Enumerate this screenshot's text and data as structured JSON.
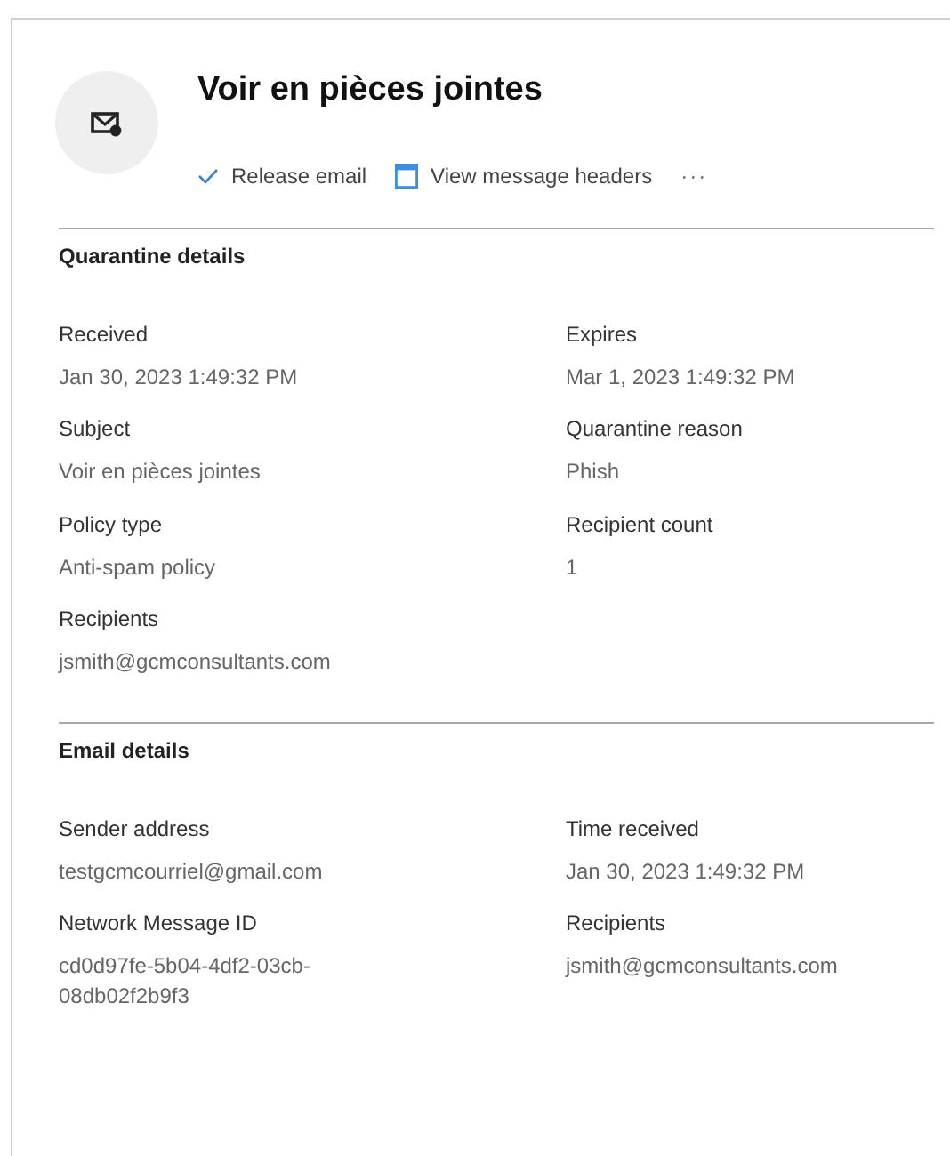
{
  "header": {
    "title": "Voir en pièces jointes",
    "actions": [
      {
        "kind": "check",
        "label": "Release email"
      },
      {
        "kind": "headers",
        "label": "View message headers"
      },
      {
        "kind": "more",
        "label": "···"
      }
    ]
  },
  "sections": [
    {
      "title": "Quarantine details",
      "fields": [
        {
          "label": "Received",
          "value": "Jan 30, 2023 1:49:32 PM"
        },
        {
          "label": "Expires",
          "value": "Mar 1, 2023 1:49:32 PM"
        },
        {
          "label": "Subject",
          "value": "Voir en pièces jointes"
        },
        {
          "label": "Quarantine reason",
          "value": "Phish"
        },
        {
          "label": "Policy type",
          "value": "Anti-spam policy"
        },
        {
          "label": "Recipient count",
          "value": "1"
        },
        {
          "label": "Recipients",
          "value": "jsmith@gcmconsultants.com"
        }
      ]
    },
    {
      "title": "Email details",
      "fields": [
        {
          "label": "Sender address",
          "value": "testgcmcourriel@gmail.com"
        },
        {
          "label": "Time received",
          "value": "Jan 30, 2023 1:49:32 PM"
        },
        {
          "label": "Network Message ID",
          "value": "cd0d97fe-5b04-4df2-03cb-08db02f2b9f3"
        },
        {
          "label": "Recipients",
          "value": "jsmith@gcmconsultants.com"
        }
      ]
    }
  ]
}
